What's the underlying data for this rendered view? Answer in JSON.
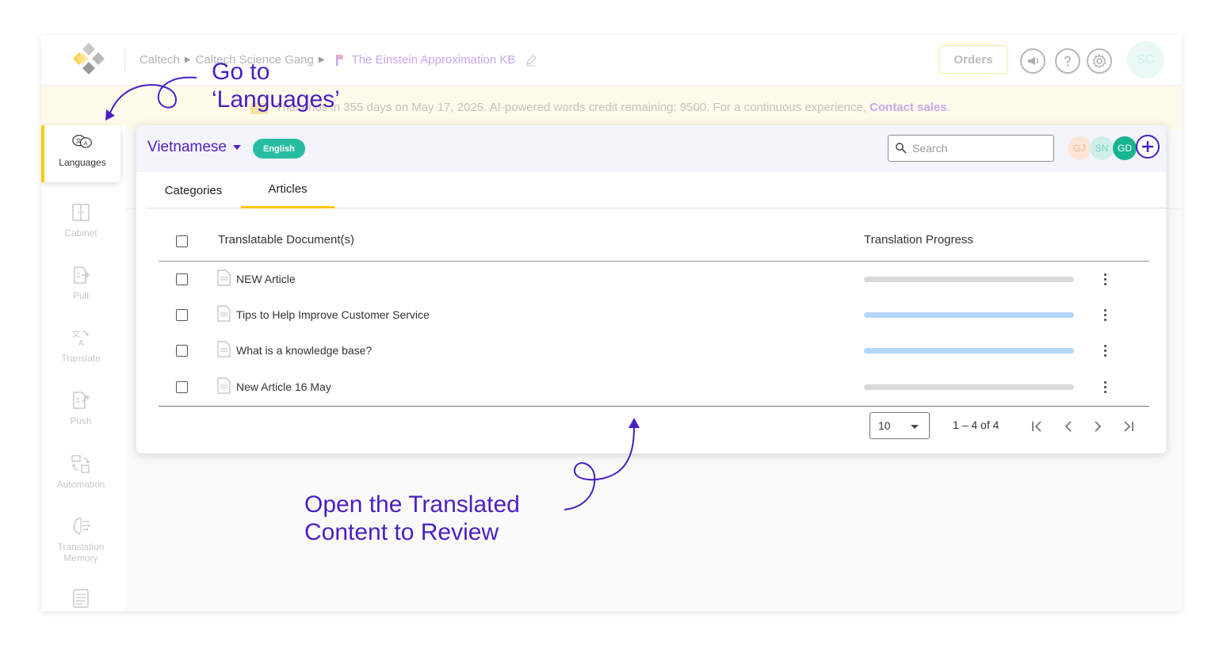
{
  "topbar": {
    "breadcrumb": [
      "Caltech",
      "Caltech Science Gang"
    ],
    "kb_name": "The Einstein Approximation KB",
    "orders_label": "Orders",
    "avatar_initials": "SC",
    "icons": [
      "megaphone-icon",
      "help-icon",
      "settings-icon"
    ]
  },
  "banner": {
    "text_prefix": "Trial ends in 355 days on May 17, 2025. AI-powered words credit remaining: 9500. For a continuous experience,",
    "link": "Contact sales",
    "suffix": "."
  },
  "sidebar": {
    "items": [
      {
        "label": "Languages",
        "icon": "languages-icon",
        "active": true
      },
      {
        "label": "Cabinet",
        "icon": "cabinet-icon"
      },
      {
        "label": "Pull",
        "icon": "pull-icon"
      },
      {
        "label": "Translate",
        "icon": "translate-icon"
      },
      {
        "label": "Push",
        "icon": "push-icon"
      },
      {
        "label": "Automation",
        "icon": "automation-icon"
      },
      {
        "label": "Translation Memory",
        "icon": "translation-memory-icon"
      },
      {
        "label": "",
        "icon": "glossary-icon"
      }
    ]
  },
  "panel": {
    "language": "Vietnamese",
    "source_badge": "English",
    "search_placeholder": "Search",
    "collaborators": [
      {
        "initials": "GJ",
        "color": "#fde6d8",
        "text": "#f1b795"
      },
      {
        "initials": "SN",
        "color": "#cdeee9",
        "text": "#7fd1c3"
      },
      {
        "initials": "GD",
        "color": "#18b48f",
        "text": "#ffffff"
      }
    ],
    "tabs": [
      "Categories",
      "Articles"
    ],
    "active_tab": "Articles"
  },
  "table": {
    "headers": {
      "document": "Translatable Document(s)",
      "progress": "Translation Progress"
    },
    "rows": [
      {
        "title": "NEW Article",
        "progress": 0
      },
      {
        "title": "Tips to Help Improve Customer Service",
        "progress": 1
      },
      {
        "title": "What is a knowledge base?",
        "progress": 1
      },
      {
        "title": "New Article 16 May",
        "progress": 0
      }
    ]
  },
  "pagination": {
    "page_size": "10",
    "range": "1 – 4 of 4"
  },
  "annotations": {
    "go_to_line1": "Go to",
    "go_to_line2": "‘Languages’",
    "open_line1": "Open the Translated",
    "open_line2": "Content to Review"
  },
  "colors": {
    "accent": "#4a1fc3",
    "active_marker": "#ffc80a",
    "badge": "#27bda3",
    "progress_fill": "#b5d6fa",
    "progress_track": "#d9d9d9"
  }
}
